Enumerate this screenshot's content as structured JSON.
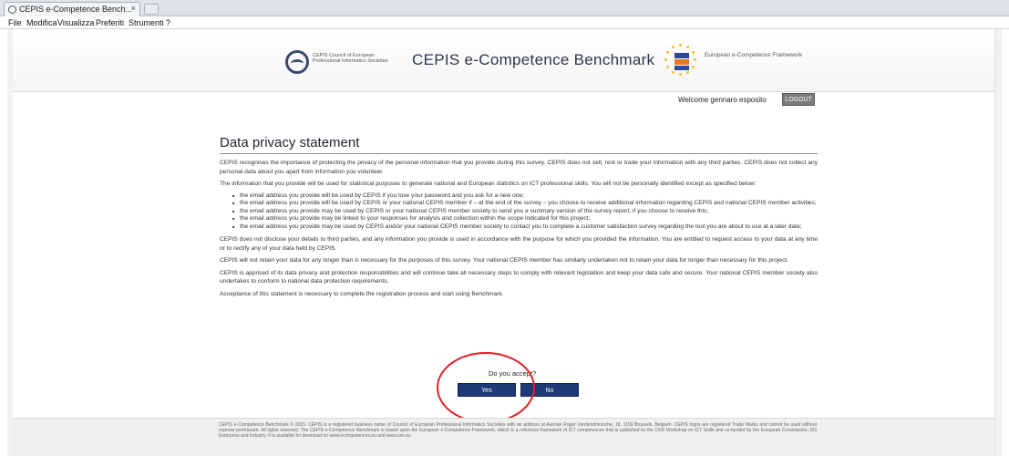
{
  "browser": {
    "tab_title": "CEPIS e-Competence Bench...",
    "tab_close": "×",
    "menu": [
      "File",
      "Modifica",
      "Visualizza",
      "Preferiti",
      "Strumenti",
      "?"
    ]
  },
  "header": {
    "org_text": "CEPIS Council of European Professional Informatics Societies",
    "title": "CEPIS e-Competence Benchmark",
    "ecf_text": "European e-Competence Framework",
    "welcome": "Welcome gennaro esposito",
    "logout_label": "LOGOUT"
  },
  "main": {
    "heading": "Data privacy statement",
    "intro": "CEPIS recognises the importance of protecting the privacy of the personal information that you provide during this survey. CEPIS does not sell, rent or trade your information with any third parties. CEPIS does not collect any personal data about you apart from information you volunteer.",
    "usage": "The information that you provide will be used for statistical purposes to generate national and European statistics on ICT professional skills. You will not be personally identified except as specified below:",
    "bullets": [
      "the email address you provide will be used by CEPIS if you lose your password and you ask for a new one;",
      "the email address you provide will be used by CEPIS or your national CEPIS member if – at the end of the survey – you choose to receive additional information regarding CEPIS and national CEPIS member activities;",
      "the email address you provide may be used by CEPIS or your national CEPIS member society to send you a summary version of the survey report, if you choose to receive this;",
      "the email address you provide may be linked to your responses for analysis and collection within the scope indicated for this project;",
      "the email address you provide may be used by CEPIS and/or your national CEPIS member society to contact you to complete a customer satisfaction survey regarding the tool you are about to use at a later date;"
    ],
    "disclosure": "CEPIS does not disclose your details to third parties, and any information you provide is used in accordance with the purpose for which you provided the information. You are entitled to request access to your data at any time or to rectify any of your data held by CEPIS.",
    "retention": "CEPIS will not retain your data for any longer than is necessary for the purposes of this survey. Your national CEPIS member has similarly undertaken not to retain your data for longer than necessary for this project.",
    "responsibilities": "CEPIS is apprised of its data privacy and protection responsibilities and will continue take all necessary steps to comply with relevant legislation and keep your data safe and secure. Your national CEPIS member society also undertakes to conform to national data protection requirements.",
    "acceptance": "Acceptance of this statement is necessary to complete the registration process and start using Benchmark.",
    "question": "Do you accept?",
    "yes_label": "Yes",
    "no_label": "No"
  },
  "footer": {
    "text": "CEPIS e-Competence Benchmark © 2015. CEPIS is a registered business name of Council of European Professional Informatics Societies with an address at Avenue Roger Vandendriessche, 18, 1150 Brussels, Belgium. CEPIS logos are registered Trade Marks and cannot be used without express permission. All rights reserved. The CEPIS e-Competence Benchmark is based upon the European e-Competence Framework, which is a reference framework of ICT competences that is published by the CEN Workshop on ICT Skills and co-funded by the European Commission, DG Enterprise and Industry. It is available for download on www.ecompetences.eu and www.cen.eu"
  },
  "colors": {
    "accent": "#1f3a78",
    "annotation": "#e21f26",
    "logout_bg": "#7b7b7b"
  }
}
